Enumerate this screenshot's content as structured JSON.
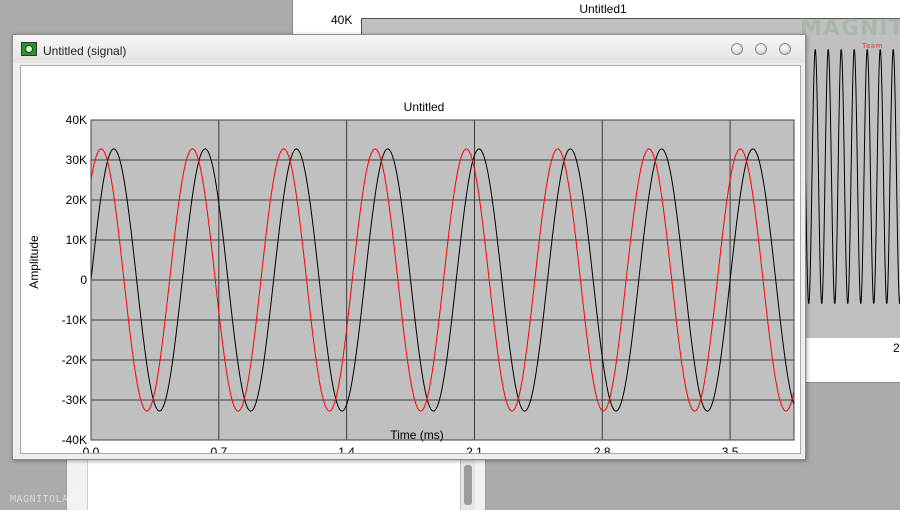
{
  "background_window": {
    "title": "Untitled1",
    "y_tick_top": "40K",
    "x_tick_partial": "2"
  },
  "logo": {
    "text": "MAGNITOLA",
    "sub": "Team"
  },
  "watermark": "MAGNITOLA [.ORG] [.RU] [.NET]",
  "window": {
    "title": "Untitled (signal)",
    "icon": "signal-app-icon"
  },
  "chart_data": {
    "type": "line",
    "title": "Untitled",
    "xlabel": "Time (ms)",
    "ylabel": "Amplitude",
    "xlim": [
      0.0,
      3.85
    ],
    "ylim": [
      -40000,
      40000
    ],
    "x_ticks": [
      0.0,
      0.7,
      1.4,
      2.1,
      2.8,
      3.5
    ],
    "x_tick_labels": [
      "0.0",
      "0.7",
      "1.4",
      "2.1",
      "2.8",
      "3.5"
    ],
    "y_ticks": [
      40000,
      30000,
      20000,
      10000,
      0,
      -10000,
      -20000,
      -30000,
      -40000
    ],
    "y_tick_labels": [
      "40K",
      "30K",
      "20K",
      "10K",
      "0",
      "-10K",
      "-20K",
      "-30K",
      "-40K"
    ],
    "grid": true,
    "background": "#c0c0c0",
    "series": [
      {
        "color": "#000000",
        "amplitude": 32768,
        "frequency_khz": 2.0,
        "phase_deg": 0
      },
      {
        "color": "#ff0000",
        "amplitude": 32768,
        "frequency_khz": 2.0,
        "phase_deg": 50
      }
    ]
  }
}
